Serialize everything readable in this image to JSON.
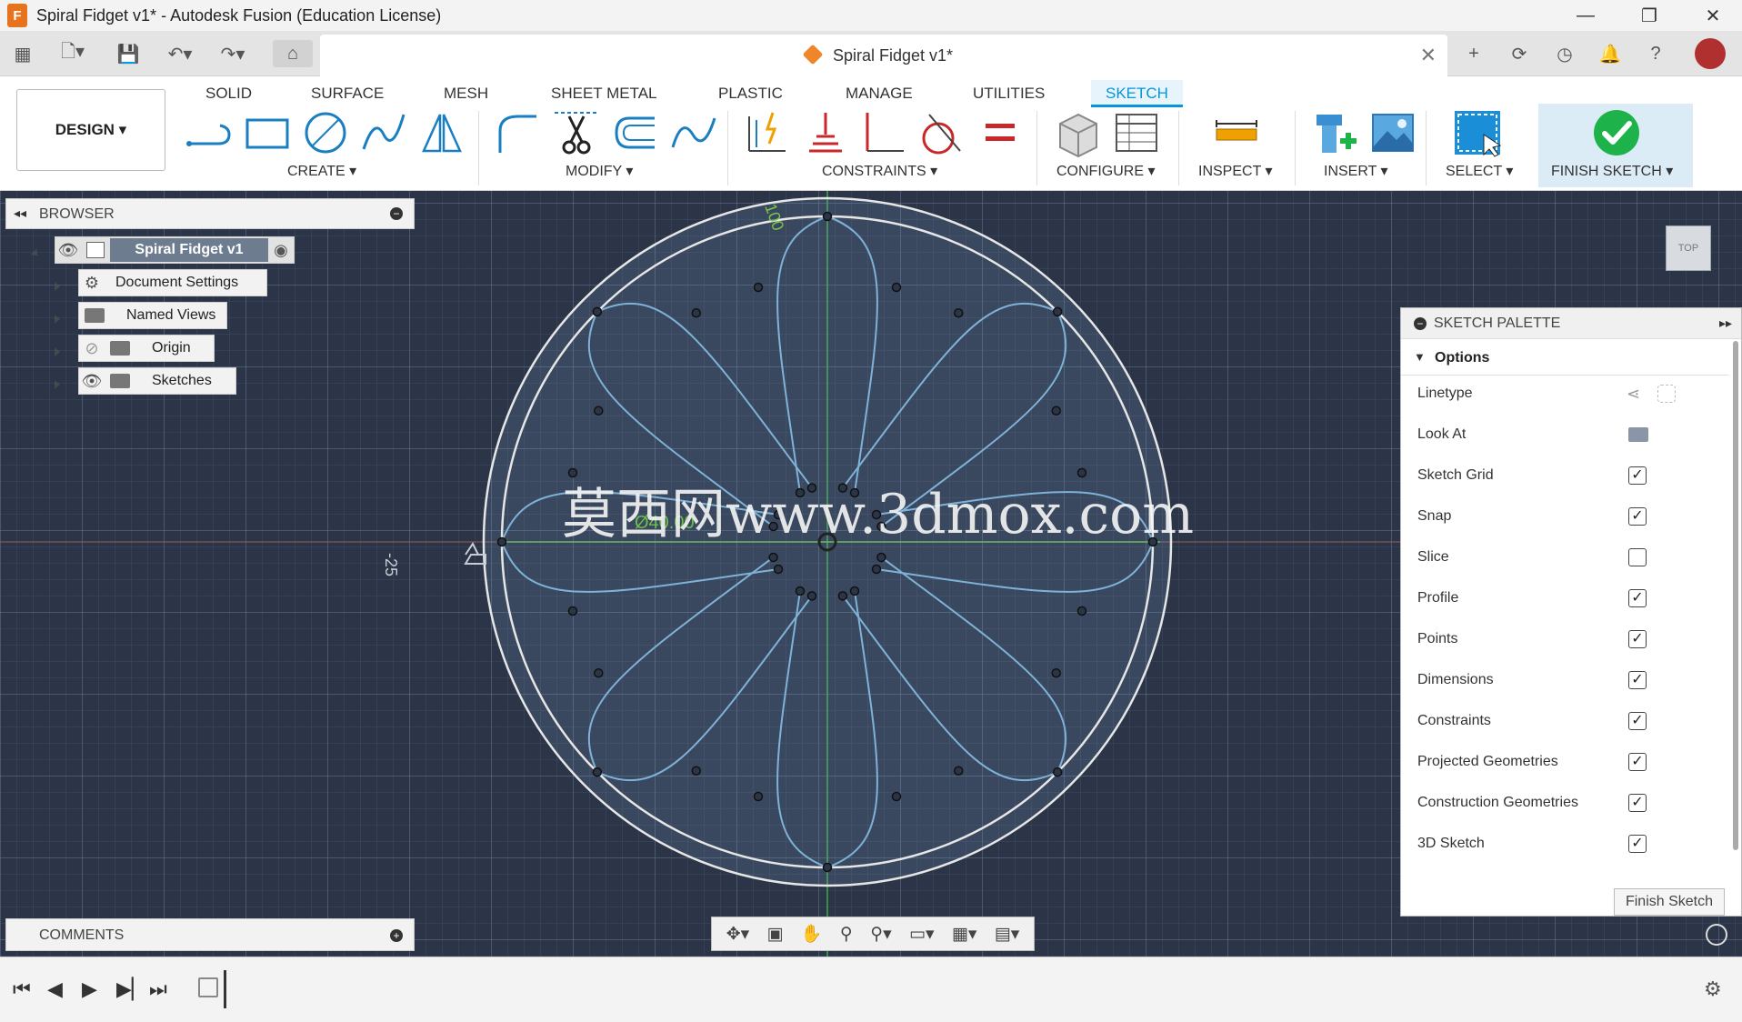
{
  "window": {
    "title": "Spiral Fidget v1* - Autodesk Fusion (Education License)",
    "app_icon_letter": "F",
    "minimize": "—",
    "restore": "❐",
    "close": "✕"
  },
  "doc_tab": {
    "label": "Spiral Fidget v1*",
    "close": "✕"
  },
  "workspace": {
    "label": "DESIGN ▾"
  },
  "ribbon_tabs": [
    "SOLID",
    "SURFACE",
    "MESH",
    "SHEET METAL",
    "PLASTIC",
    "MANAGE",
    "UTILITIES",
    "SKETCH"
  ],
  "groups": {
    "create": "CREATE ▾",
    "modify": "MODIFY ▾",
    "constraints": "CONSTRAINTS ▾",
    "configure": "CONFIGURE ▾",
    "inspect": "INSPECT ▾",
    "insert": "INSERT ▾",
    "select": "SELECT ▾",
    "finish": "FINISH SKETCH ▾"
  },
  "browser": {
    "title": "BROWSER",
    "root": "Spiral Fidget v1",
    "items": [
      "Document Settings",
      "Named Views",
      "Origin",
      "Sketches"
    ]
  },
  "comments": {
    "title": "COMMENTS"
  },
  "palette": {
    "title": "SKETCH PALETTE",
    "section": "Options",
    "rows": [
      {
        "label": "Linetype",
        "type": "icons"
      },
      {
        "label": "Look At",
        "type": "icon"
      },
      {
        "label": "Sketch Grid",
        "type": "check",
        "checked": true
      },
      {
        "label": "Snap",
        "type": "check",
        "checked": true
      },
      {
        "label": "Slice",
        "type": "check",
        "checked": false
      },
      {
        "label": "Profile",
        "type": "check",
        "checked": true
      },
      {
        "label": "Points",
        "type": "check",
        "checked": true
      },
      {
        "label": "Dimensions",
        "type": "check",
        "checked": true
      },
      {
        "label": "Constraints",
        "type": "check",
        "checked": true
      },
      {
        "label": "Projected Geometries",
        "type": "check",
        "checked": true
      },
      {
        "label": "Construction Geometries",
        "type": "check",
        "checked": true
      },
      {
        "label": "3D Sketch",
        "type": "check",
        "checked": true
      }
    ],
    "finish_button": "Finish Sketch"
  },
  "canvas": {
    "dimension_diameter": "Ø40.00",
    "ruler_top": "100",
    "ruler_left": "-25",
    "watermark": "莫西网www.3dmox.com",
    "viewcube": "TOP"
  },
  "colors": {
    "canvas_bg": "#2b3547",
    "sketch_line": "#7fb2d8",
    "accent": "#0696d7",
    "finish_green": "#1db34a"
  }
}
